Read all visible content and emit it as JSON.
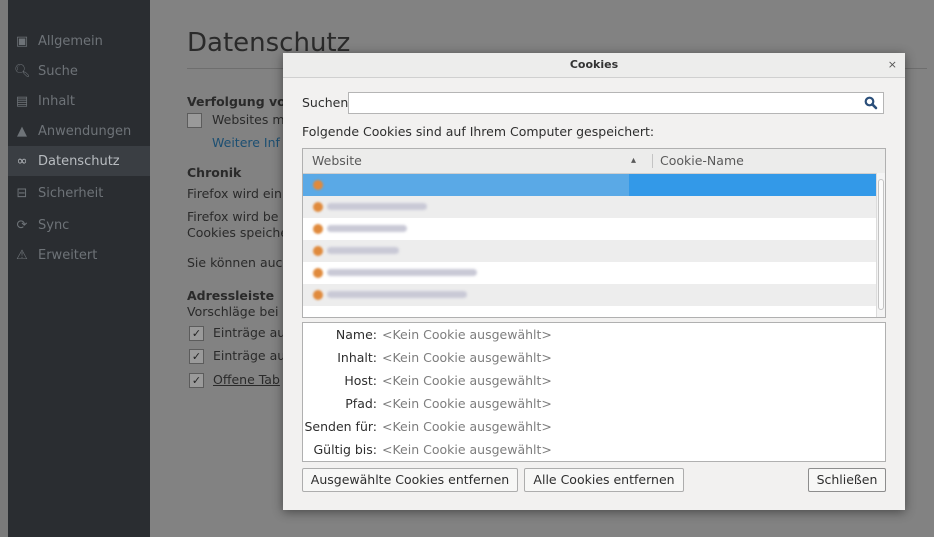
{
  "sidebar": {
    "items": [
      {
        "label": "Allgemein",
        "icon": "general-icon",
        "glyph": "▣",
        "active": false
      },
      {
        "label": "Suche",
        "icon": "search-icon",
        "glyph": "🔍︎",
        "active": false
      },
      {
        "label": "Inhalt",
        "icon": "content-icon",
        "glyph": "▤",
        "active": false
      },
      {
        "label": "Anwendungen",
        "icon": "applications-icon",
        "glyph": "▲",
        "active": false
      },
      {
        "label": "Datenschutz",
        "icon": "privacy-mask-icon",
        "glyph": "∞",
        "active": true
      },
      {
        "label": "Sicherheit",
        "icon": "security-lock-icon",
        "glyph": "⊟",
        "active": false
      },
      {
        "label": "Sync",
        "icon": "sync-icon",
        "glyph": "⟳",
        "active": false
      },
      {
        "label": "Erweitert",
        "icon": "advanced-icon",
        "glyph": "⚠",
        "active": false
      }
    ]
  },
  "pane": {
    "title": "Datenschutz",
    "tracking_heading": "Verfolgung vo",
    "tracking_option": "Websites m",
    "tracking_link": "Weitere Inf",
    "history_heading": "Chronik",
    "history_text1": "Firefox wird ein",
    "history_text2": "Firefox wird be",
    "history_text3": "Cookies speiche",
    "history_text4": "Sie können auc",
    "address_heading": "Adressleiste",
    "address_sub": "Vorschläge bei",
    "address_opt1": "Einträge au",
    "address_opt2": "Einträge au",
    "address_opt3": "Offene Tab"
  },
  "dialog": {
    "title": "Cookies",
    "close_glyph": "×",
    "search_label": "Suchen",
    "search_value": "",
    "search_icon": "magnifier-icon",
    "info_text": "Folgende Cookies sind auf Ihrem Computer gespeichert:",
    "columns": {
      "website": "Website",
      "sort_glyph": "▴",
      "cookie_name": "Cookie-Name"
    },
    "details": {
      "name_key": "Name:",
      "content_key": "Inhalt:",
      "host_key": "Host:",
      "path_key": "Pfad:",
      "send_key": "Senden für:",
      "expires_key": "Gültig bis:",
      "empty_value": "<Kein Cookie ausgewählt>"
    },
    "buttons": {
      "remove_selected": "Ausgewählte Cookies entfernen",
      "remove_all": "Alle Cookies entfernen",
      "close": "Schließen"
    },
    "colors": {
      "selection": "#3399e8"
    }
  }
}
